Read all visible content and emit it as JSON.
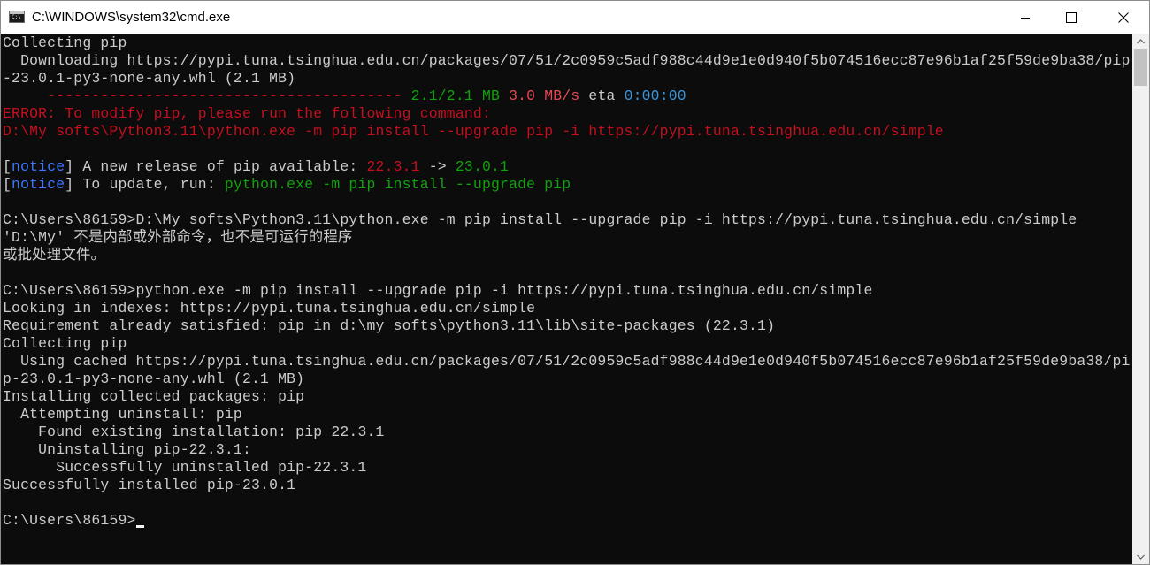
{
  "window": {
    "title": "C:\\WINDOWS\\system32\\cmd.exe",
    "icon": "cmd-console-icon",
    "controls": {
      "minimize_icon": "minimize-icon",
      "maximize_icon": "maximize-icon",
      "close_icon": "close-icon"
    }
  },
  "colors": {
    "background": "#0c0c0c",
    "default_text": "#cccccc",
    "red": "#e74856",
    "green": "#13a10e",
    "blue": "#3b78ff",
    "cyan": "#3a96dd"
  },
  "console": {
    "lines": [
      [
        {
          "t": "Collecting pip",
          "c": "default"
        }
      ],
      [
        {
          "t": "  Downloading https://pypi.tuna.tsinghua.edu.cn/packages/07/51/2c0959c5adf988c44d9e1e0d940f5b074516ecc87e96b1af25f59de9ba38/pip",
          "c": "default"
        }
      ],
      [
        {
          "t": "-23.0.1-py3-none-any.whl (2.1 MB)",
          "c": "default"
        }
      ],
      [
        {
          "t": "     ---------------------------------------- ",
          "c": "darkred"
        },
        {
          "t": "2.1/2.1 MB",
          "c": "green"
        },
        {
          "t": " ",
          "c": "default"
        },
        {
          "t": "3.0 MB/s",
          "c": "red"
        },
        {
          "t": " eta ",
          "c": "default"
        },
        {
          "t": "0:00:00",
          "c": "cyan"
        }
      ],
      [
        {
          "t": "ERROR: To modify pip, please run the following command:",
          "c": "darkred"
        }
      ],
      [
        {
          "t": "D:\\My softs\\Python3.11\\python.exe -m pip install --upgrade pip -i https://pypi.tuna.tsinghua.edu.cn/simple",
          "c": "darkred"
        }
      ],
      [
        {
          "t": "",
          "c": "default"
        }
      ],
      [
        {
          "t": "[",
          "c": "default"
        },
        {
          "t": "notice",
          "c": "blue"
        },
        {
          "t": "] A new release of pip available: ",
          "c": "default"
        },
        {
          "t": "22.3.1",
          "c": "darkred"
        },
        {
          "t": " -> ",
          "c": "default"
        },
        {
          "t": "23.0.1",
          "c": "green"
        }
      ],
      [
        {
          "t": "[",
          "c": "default"
        },
        {
          "t": "notice",
          "c": "blue"
        },
        {
          "t": "] To update, run: ",
          "c": "default"
        },
        {
          "t": "python.exe -m pip install --upgrade pip",
          "c": "green"
        }
      ],
      [
        {
          "t": "",
          "c": "default"
        }
      ],
      [
        {
          "t": "C:\\Users\\86159>D:\\My softs\\Python3.11\\python.exe -m pip install --upgrade pip -i https://pypi.tuna.tsinghua.edu.cn/simple",
          "c": "default"
        }
      ],
      [
        {
          "t": "'D:\\My' 不是内部或外部命令，也不是可运行的程序",
          "c": "default"
        }
      ],
      [
        {
          "t": "或批处理文件。",
          "c": "default"
        }
      ],
      [
        {
          "t": "",
          "c": "default"
        }
      ],
      [
        {
          "t": "C:\\Users\\86159>python.exe -m pip install --upgrade pip -i https://pypi.tuna.tsinghua.edu.cn/simple",
          "c": "default"
        }
      ],
      [
        {
          "t": "Looking in indexes: https://pypi.tuna.tsinghua.edu.cn/simple",
          "c": "default"
        }
      ],
      [
        {
          "t": "Requirement already satisfied: pip in d:\\my softs\\python3.11\\lib\\site-packages (22.3.1)",
          "c": "default"
        }
      ],
      [
        {
          "t": "Collecting pip",
          "c": "default"
        }
      ],
      [
        {
          "t": "  Using cached https://pypi.tuna.tsinghua.edu.cn/packages/07/51/2c0959c5adf988c44d9e1e0d940f5b074516ecc87e96b1af25f59de9ba38/pi",
          "c": "default"
        }
      ],
      [
        {
          "t": "p-23.0.1-py3-none-any.whl (2.1 MB)",
          "c": "default"
        }
      ],
      [
        {
          "t": "Installing collected packages: pip",
          "c": "default"
        }
      ],
      [
        {
          "t": "  Attempting uninstall: pip",
          "c": "default"
        }
      ],
      [
        {
          "t": "    Found existing installation: pip 22.3.1",
          "c": "default"
        }
      ],
      [
        {
          "t": "    Uninstalling pip-22.3.1:",
          "c": "default"
        }
      ],
      [
        {
          "t": "      Successfully uninstalled pip-22.3.1",
          "c": "default"
        }
      ],
      [
        {
          "t": "Successfully installed pip-23.0.1",
          "c": "default"
        }
      ],
      [
        {
          "t": "",
          "c": "default"
        }
      ],
      [
        {
          "t": "C:\\Users\\86159>",
          "c": "default"
        }
      ]
    ],
    "cursor_after_last_line": true
  },
  "scrollbar": {
    "up_icon": "scroll-up-arrow-icon",
    "down_icon": "scroll-down-arrow-icon"
  }
}
